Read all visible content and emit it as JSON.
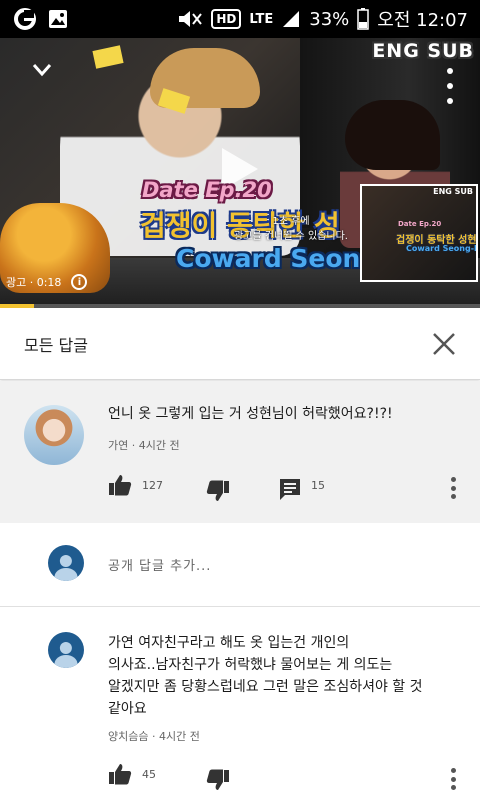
{
  "status_bar": {
    "battery_percent": "33%",
    "time": "오전 12:07",
    "network": "LTE",
    "hd_label": "HD"
  },
  "video": {
    "overlay_badge": "ENG SUB",
    "title_line1": "Date Ep.20",
    "title_line2": "겁쟁이 동탁한 성",
    "title_line3": "Coward Seong-hyun?",
    "skip_message_line1": "1초 후에",
    "skip_message_line2": "광고를 건너뛸 수 있습니다.",
    "ad_label": "광고 · 0:18",
    "progress_fraction": 0.07,
    "preview": {
      "badge": "ENG SUB",
      "date": "Date Ep.20",
      "kr": "겁쟁이 동탁한 성현이?",
      "en": "Coward Seong-hyun?"
    }
  },
  "replies_panel": {
    "title": "모든 답글"
  },
  "main_comment": {
    "text": "언니 옷 그렇게 입는 거 성현님이 허락했어요?!?!",
    "author": "가연",
    "time": "4시간 전",
    "likes": "127",
    "replies": "15"
  },
  "add_reply": {
    "placeholder": "공개 답글 추가..."
  },
  "reply_comment": {
    "text_lines": [
      "가연 여자친구라고 해도 옷 입는건 개인의",
      "의사죠..남자친구가 허락했냐 물어보는 게 의도는",
      "알겠지만 좀 당황스럽네요 그런 말은 조심하셔야 할 것",
      "같아요"
    ],
    "author": "양치슴슴",
    "time": "4시간 전",
    "likes": "45"
  },
  "colors": {
    "accent_yellow": "#f2c230",
    "avatar_blue": "#1f5b8f",
    "comment_bg": "#f1f1f1",
    "icon_dark": "#333333"
  }
}
